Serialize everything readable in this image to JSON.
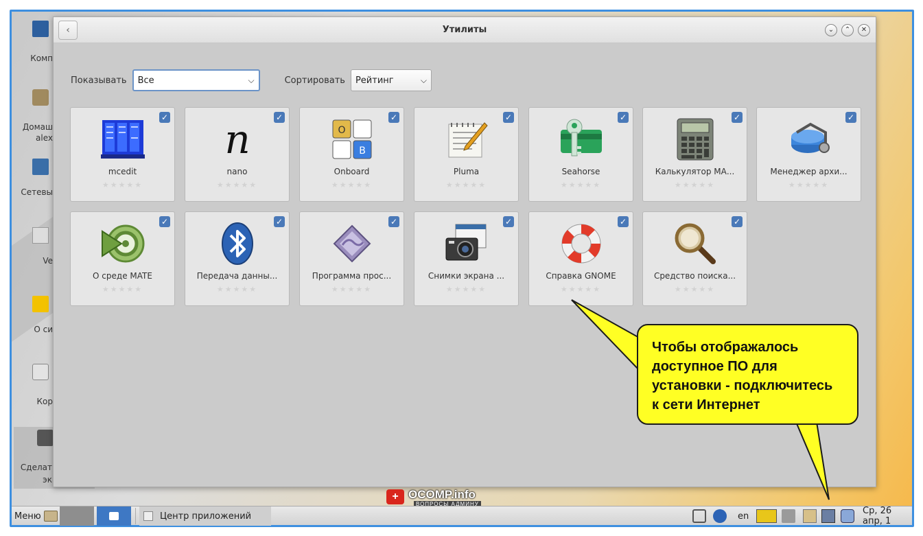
{
  "window": {
    "title": "Утилиты"
  },
  "filters": {
    "show_label": "Показывать",
    "show_value": "Все",
    "sort_label": "Сортировать",
    "sort_value": "Рейтинг"
  },
  "apps": [
    {
      "name": "mcedit",
      "icon": "mcedit-icon",
      "checked": true
    },
    {
      "name": "nano",
      "icon": "nano-icon",
      "checked": true
    },
    {
      "name": "Onboard",
      "icon": "onboard-icon",
      "checked": true
    },
    {
      "name": "Pluma",
      "icon": "pluma-icon",
      "checked": true
    },
    {
      "name": "Seahorse",
      "icon": "seahorse-icon",
      "checked": true
    },
    {
      "name": "Калькулятор МА...",
      "icon": "calculator-icon",
      "checked": true
    },
    {
      "name": "Менеджер архи...",
      "icon": "archive-manager-icon",
      "checked": true
    },
    {
      "name": "О среде MATE",
      "icon": "mate-about-icon",
      "checked": true
    },
    {
      "name": "Передача данны...",
      "icon": "bluetooth-icon",
      "checked": true
    },
    {
      "name": "Программа прос...",
      "icon": "viewer-icon",
      "checked": true
    },
    {
      "name": "Снимки экрана ...",
      "icon": "screenshot-icon",
      "checked": true
    },
    {
      "name": "Справка GNOME",
      "icon": "help-lifebuoy-icon",
      "checked": true
    },
    {
      "name": "Средство поиска...",
      "icon": "search-tool-icon",
      "checked": true
    }
  ],
  "onboard_keys": [
    "O",
    "B"
  ],
  "stars": "★★★★★",
  "callout": {
    "line1": "Чтобы отображалось",
    "line2": "доступное ПО для",
    "line3": "установки - подключитесь",
    "line4": "к сети Интернет"
  },
  "desktop_labels": [
    "Комп",
    "Домаш",
    "alex",
    "Сетевы",
    "Ve",
    "О си",
    "Кор",
    "Сделат",
    "эк"
  ],
  "taskbar": {
    "menu_label": "Меню",
    "task_label": "Центр приложений",
    "lang": "en",
    "clock": "Ср, 26 апр, 1"
  },
  "watermark": {
    "brand": "OCOMP.info",
    "tagline": "ВОПРОСЫ АДМИНУ"
  },
  "colors": {
    "callout_bg": "#ffff24",
    "check_bg": "#4a79b8",
    "frame": "#3d8fe0"
  }
}
